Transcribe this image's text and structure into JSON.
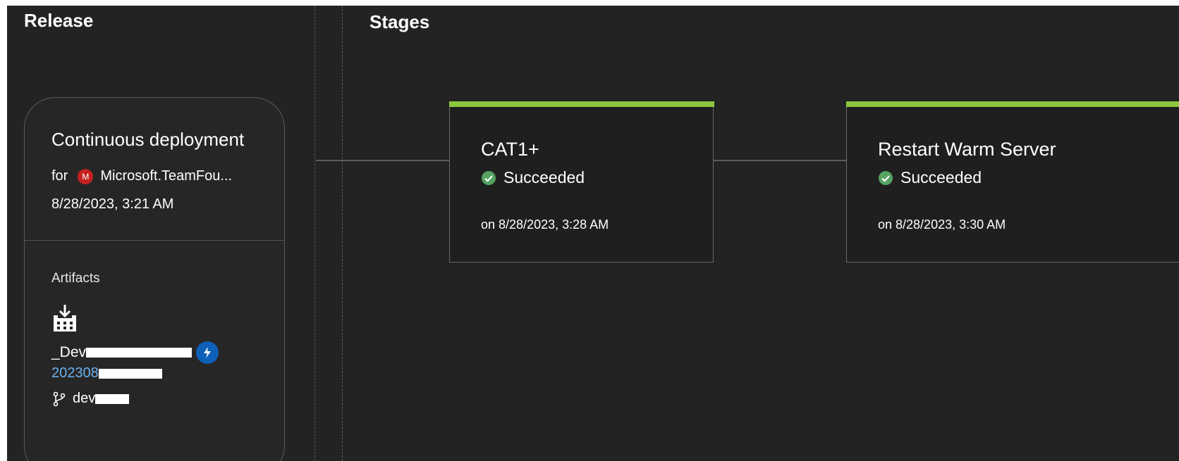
{
  "release": {
    "title": "Release",
    "card": {
      "trigger_title": "Continuous deployment",
      "for_label": "for",
      "requester_initial": "M",
      "requester_name": "Microsoft.TeamFou...",
      "date": "8/28/2023, 3:21 AM",
      "artifacts_label": "Artifacts",
      "artifact_name_prefix": "_Dev",
      "artifact_build_prefix": "202308",
      "artifact_branch_prefix": "dev"
    }
  },
  "stages": {
    "title": "Stages",
    "items": [
      {
        "name": "CAT1+",
        "status": "Succeeded",
        "time": "on 8/28/2023, 3:28 AM"
      },
      {
        "name": "Restart Warm Server",
        "status": "Succeeded",
        "time": "on 8/28/2023, 3:30 AM"
      }
    ]
  },
  "colors": {
    "background": "#232323",
    "success_bar": "#8dc63f",
    "success_icon": "#55a362",
    "link": "#6cb2f2",
    "avatar": "#c62020",
    "trigger_badge": "#0e5fb8"
  },
  "icons": {
    "requester_avatar": "avatar-icon",
    "artifact": "build-artifact-icon",
    "trigger": "continuous-deployment-trigger-icon",
    "branch": "git-branch-icon",
    "status": "success-check-icon"
  }
}
